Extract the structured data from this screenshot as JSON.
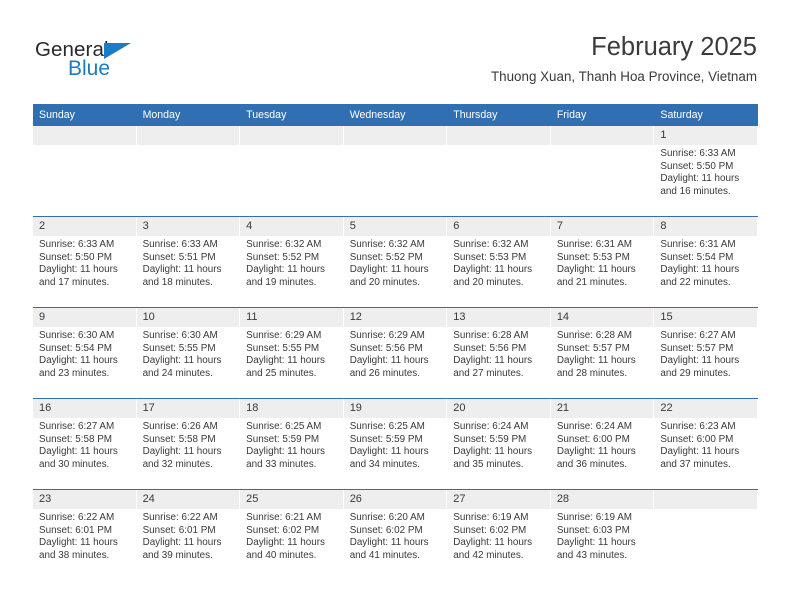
{
  "brand": {
    "name_top": "General",
    "name_bottom": "Blue",
    "triangle_color": "#1b7bc4",
    "text_color": "#28292b",
    "blue_color": "#1b7bc4"
  },
  "header": {
    "title": "February 2025",
    "subtitle": "Thuong Xuan, Thanh Hoa Province, Vietnam",
    "accent_color": "#3070b2",
    "daynum_band_color": "#eeeeee"
  },
  "weekday_headers": [
    "Sunday",
    "Monday",
    "Tuesday",
    "Wednesday",
    "Thursday",
    "Friday",
    "Saturday"
  ],
  "weeks": [
    [
      {
        "day": "",
        "sunrise": "",
        "sunset": "",
        "daylight_line1": "",
        "daylight_line2": ""
      },
      {
        "day": "",
        "sunrise": "",
        "sunset": "",
        "daylight_line1": "",
        "daylight_line2": ""
      },
      {
        "day": "",
        "sunrise": "",
        "sunset": "",
        "daylight_line1": "",
        "daylight_line2": ""
      },
      {
        "day": "",
        "sunrise": "",
        "sunset": "",
        "daylight_line1": "",
        "daylight_line2": ""
      },
      {
        "day": "",
        "sunrise": "",
        "sunset": "",
        "daylight_line1": "",
        "daylight_line2": ""
      },
      {
        "day": "",
        "sunrise": "",
        "sunset": "",
        "daylight_line1": "",
        "daylight_line2": ""
      },
      {
        "day": "1",
        "sunrise": "Sunrise: 6:33 AM",
        "sunset": "Sunset: 5:50 PM",
        "daylight_line1": "Daylight: 11 hours",
        "daylight_line2": "and 16 minutes."
      }
    ],
    [
      {
        "day": "2",
        "sunrise": "Sunrise: 6:33 AM",
        "sunset": "Sunset: 5:50 PM",
        "daylight_line1": "Daylight: 11 hours",
        "daylight_line2": "and 17 minutes."
      },
      {
        "day": "3",
        "sunrise": "Sunrise: 6:33 AM",
        "sunset": "Sunset: 5:51 PM",
        "daylight_line1": "Daylight: 11 hours",
        "daylight_line2": "and 18 minutes."
      },
      {
        "day": "4",
        "sunrise": "Sunrise: 6:32 AM",
        "sunset": "Sunset: 5:52 PM",
        "daylight_line1": "Daylight: 11 hours",
        "daylight_line2": "and 19 minutes."
      },
      {
        "day": "5",
        "sunrise": "Sunrise: 6:32 AM",
        "sunset": "Sunset: 5:52 PM",
        "daylight_line1": "Daylight: 11 hours",
        "daylight_line2": "and 20 minutes."
      },
      {
        "day": "6",
        "sunrise": "Sunrise: 6:32 AM",
        "sunset": "Sunset: 5:53 PM",
        "daylight_line1": "Daylight: 11 hours",
        "daylight_line2": "and 20 minutes."
      },
      {
        "day": "7",
        "sunrise": "Sunrise: 6:31 AM",
        "sunset": "Sunset: 5:53 PM",
        "daylight_line1": "Daylight: 11 hours",
        "daylight_line2": "and 21 minutes."
      },
      {
        "day": "8",
        "sunrise": "Sunrise: 6:31 AM",
        "sunset": "Sunset: 5:54 PM",
        "daylight_line1": "Daylight: 11 hours",
        "daylight_line2": "and 22 minutes."
      }
    ],
    [
      {
        "day": "9",
        "sunrise": "Sunrise: 6:30 AM",
        "sunset": "Sunset: 5:54 PM",
        "daylight_line1": "Daylight: 11 hours",
        "daylight_line2": "and 23 minutes."
      },
      {
        "day": "10",
        "sunrise": "Sunrise: 6:30 AM",
        "sunset": "Sunset: 5:55 PM",
        "daylight_line1": "Daylight: 11 hours",
        "daylight_line2": "and 24 minutes."
      },
      {
        "day": "11",
        "sunrise": "Sunrise: 6:29 AM",
        "sunset": "Sunset: 5:55 PM",
        "daylight_line1": "Daylight: 11 hours",
        "daylight_line2": "and 25 minutes."
      },
      {
        "day": "12",
        "sunrise": "Sunrise: 6:29 AM",
        "sunset": "Sunset: 5:56 PM",
        "daylight_line1": "Daylight: 11 hours",
        "daylight_line2": "and 26 minutes."
      },
      {
        "day": "13",
        "sunrise": "Sunrise: 6:28 AM",
        "sunset": "Sunset: 5:56 PM",
        "daylight_line1": "Daylight: 11 hours",
        "daylight_line2": "and 27 minutes."
      },
      {
        "day": "14",
        "sunrise": "Sunrise: 6:28 AM",
        "sunset": "Sunset: 5:57 PM",
        "daylight_line1": "Daylight: 11 hours",
        "daylight_line2": "and 28 minutes."
      },
      {
        "day": "15",
        "sunrise": "Sunrise: 6:27 AM",
        "sunset": "Sunset: 5:57 PM",
        "daylight_line1": "Daylight: 11 hours",
        "daylight_line2": "and 29 minutes."
      }
    ],
    [
      {
        "day": "16",
        "sunrise": "Sunrise: 6:27 AM",
        "sunset": "Sunset: 5:58 PM",
        "daylight_line1": "Daylight: 11 hours",
        "daylight_line2": "and 30 minutes."
      },
      {
        "day": "17",
        "sunrise": "Sunrise: 6:26 AM",
        "sunset": "Sunset: 5:58 PM",
        "daylight_line1": "Daylight: 11 hours",
        "daylight_line2": "and 32 minutes."
      },
      {
        "day": "18",
        "sunrise": "Sunrise: 6:25 AM",
        "sunset": "Sunset: 5:59 PM",
        "daylight_line1": "Daylight: 11 hours",
        "daylight_line2": "and 33 minutes."
      },
      {
        "day": "19",
        "sunrise": "Sunrise: 6:25 AM",
        "sunset": "Sunset: 5:59 PM",
        "daylight_line1": "Daylight: 11 hours",
        "daylight_line2": "and 34 minutes."
      },
      {
        "day": "20",
        "sunrise": "Sunrise: 6:24 AM",
        "sunset": "Sunset: 5:59 PM",
        "daylight_line1": "Daylight: 11 hours",
        "daylight_line2": "and 35 minutes."
      },
      {
        "day": "21",
        "sunrise": "Sunrise: 6:24 AM",
        "sunset": "Sunset: 6:00 PM",
        "daylight_line1": "Daylight: 11 hours",
        "daylight_line2": "and 36 minutes."
      },
      {
        "day": "22",
        "sunrise": "Sunrise: 6:23 AM",
        "sunset": "Sunset: 6:00 PM",
        "daylight_line1": "Daylight: 11 hours",
        "daylight_line2": "and 37 minutes."
      }
    ],
    [
      {
        "day": "23",
        "sunrise": "Sunrise: 6:22 AM",
        "sunset": "Sunset: 6:01 PM",
        "daylight_line1": "Daylight: 11 hours",
        "daylight_line2": "and 38 minutes."
      },
      {
        "day": "24",
        "sunrise": "Sunrise: 6:22 AM",
        "sunset": "Sunset: 6:01 PM",
        "daylight_line1": "Daylight: 11 hours",
        "daylight_line2": "and 39 minutes."
      },
      {
        "day": "25",
        "sunrise": "Sunrise: 6:21 AM",
        "sunset": "Sunset: 6:02 PM",
        "daylight_line1": "Daylight: 11 hours",
        "daylight_line2": "and 40 minutes."
      },
      {
        "day": "26",
        "sunrise": "Sunrise: 6:20 AM",
        "sunset": "Sunset: 6:02 PM",
        "daylight_line1": "Daylight: 11 hours",
        "daylight_line2": "and 41 minutes."
      },
      {
        "day": "27",
        "sunrise": "Sunrise: 6:19 AM",
        "sunset": "Sunset: 6:02 PM",
        "daylight_line1": "Daylight: 11 hours",
        "daylight_line2": "and 42 minutes."
      },
      {
        "day": "28",
        "sunrise": "Sunrise: 6:19 AM",
        "sunset": "Sunset: 6:03 PM",
        "daylight_line1": "Daylight: 11 hours",
        "daylight_line2": "and 43 minutes."
      },
      {
        "day": "",
        "sunrise": "",
        "sunset": "",
        "daylight_line1": "",
        "daylight_line2": ""
      }
    ]
  ]
}
